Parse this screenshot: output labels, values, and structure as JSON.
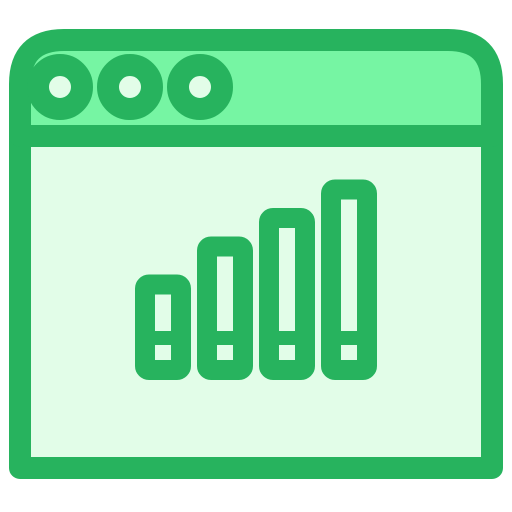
{
  "icon": {
    "name": "browser-window-bar-chart-icon",
    "colors": {
      "stroke": "#27b35e",
      "titlebar_fill": "#76f5a3",
      "body_fill": "#e2fde8",
      "dot_fill": "#e2fde8"
    },
    "window_controls": [
      "window-dot-1",
      "window-dot-2",
      "window-dot-3"
    ],
    "bar_chart": {
      "bars": [
        {
          "name": "bar-1",
          "level": 0.45
        },
        {
          "name": "bar-2",
          "level": 0.65
        },
        {
          "name": "bar-3",
          "level": 0.8
        },
        {
          "name": "bar-4",
          "level": 0.95
        }
      ]
    }
  }
}
